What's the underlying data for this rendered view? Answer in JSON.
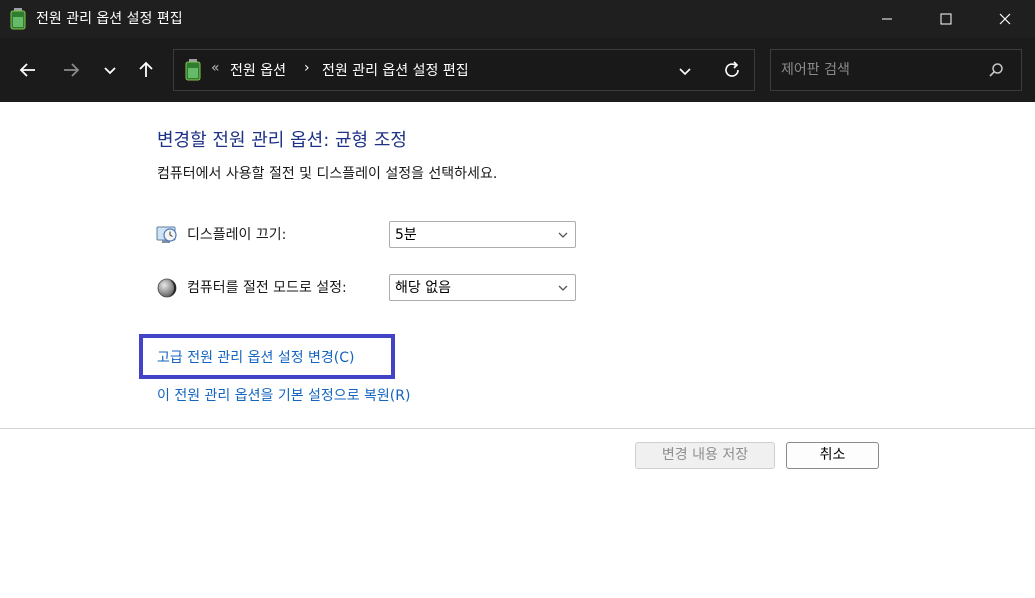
{
  "window": {
    "title": "전원 관리 옵션 설정 편집"
  },
  "navbar": {
    "breadcrumb": {
      "chevron": "«",
      "items": [
        "전원 옵션",
        "전원 관리 옵션 설정 편집"
      ],
      "separator": "›"
    },
    "search": {
      "placeholder": "제어판 검색"
    }
  },
  "content": {
    "heading": "변경할 전원 관리 옵션: 균형 조정",
    "subtext": "컴퓨터에서 사용할 절전 및 디스플레이 설정을 선택하세요.",
    "settings": [
      {
        "label": "디스플레이 끄기:",
        "value": "5분",
        "icon": "monitor-clock-icon"
      },
      {
        "label": "컴퓨터를 절전 모드로 설정:",
        "value": "해당 없음",
        "icon": "moon-icon"
      }
    ],
    "links": {
      "advanced": "고급 전원 관리 옵션 설정 변경(C)",
      "restore": "이 전원 관리 옵션을 기본 설정으로 복원(R)"
    },
    "buttons": {
      "save": "변경 내용 저장",
      "cancel": "취소"
    }
  },
  "colors": {
    "titlebar": "#1f1f1f",
    "heading": "#1e3287",
    "link": "#1565c0",
    "highlight": "#4343c8"
  }
}
